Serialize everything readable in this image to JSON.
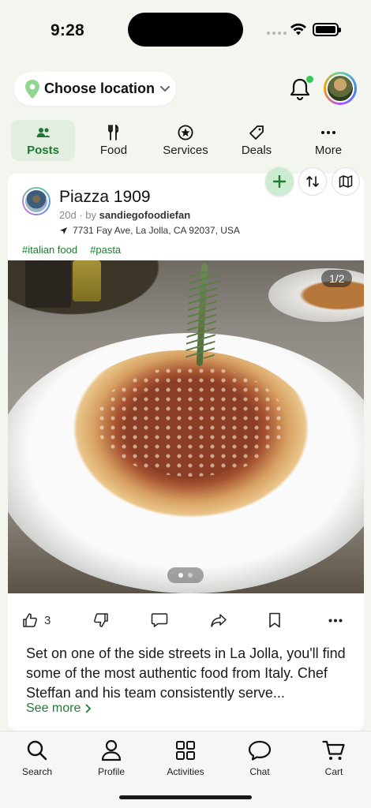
{
  "status_bar": {
    "time": "9:28"
  },
  "header": {
    "location_label": "Choose location",
    "notification_dot_color": "#35c759"
  },
  "tabs": [
    {
      "label": "Posts",
      "icon": "people-icon",
      "active": true
    },
    {
      "label": "Food",
      "icon": "fork-knife-icon"
    },
    {
      "label": "Services",
      "icon": "star-circle-icon"
    },
    {
      "label": "Deals",
      "icon": "tag-icon"
    },
    {
      "label": "More",
      "icon": "more-dots-icon"
    }
  ],
  "post": {
    "title": "Piazza 1909",
    "age": "20d",
    "by_text": "· by",
    "author": "sandiegofoodiefan",
    "address": "7731 Fay Ave, La Jolla, CA 92037, USA",
    "tags": [
      "#italian food",
      "#pasta"
    ],
    "photo_counter": "1/2",
    "likes": "3",
    "body": "Set on one of the side streets in La Jolla, you'll find some of the most authentic food from Italy. Chef Steffan and his team consistently serve...",
    "see_more": "See more"
  },
  "bottom_nav": [
    {
      "label": "Search",
      "icon": "search-icon"
    },
    {
      "label": "Profile",
      "icon": "profile-icon"
    },
    {
      "label": "Activities",
      "icon": "grid-icon"
    },
    {
      "label": "Chat",
      "icon": "chat-icon"
    },
    {
      "label": "Cart",
      "icon": "cart-icon"
    }
  ],
  "colors": {
    "accent": "#1e7a33",
    "active_tab_bg": "#e1eee0",
    "add_button_bg": "#cdebd0"
  }
}
